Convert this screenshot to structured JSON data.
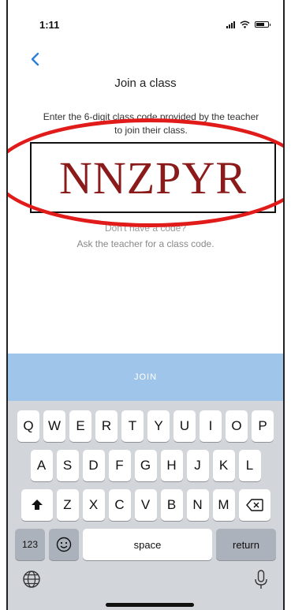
{
  "status_bar": {
    "time": "1:11"
  },
  "header": {
    "back_icon": "chevron-left-icon",
    "title": "Join a class"
  },
  "instruction": "Enter the 6-digit class code provided by the teacher to join their class.",
  "code": "NNZPYR",
  "help": {
    "question": "Don't have a code?",
    "hint": "Ask the teacher for a class code."
  },
  "join_button": {
    "label": "JOIN"
  },
  "colors": {
    "accent": "#2b7fd8",
    "join_bg": "#9fc6ea",
    "annotation": "#e11a1a",
    "code_text": "#8b1a1a"
  },
  "keyboard": {
    "row1": [
      "Q",
      "W",
      "E",
      "R",
      "T",
      "Y",
      "U",
      "I",
      "O",
      "P"
    ],
    "row2": [
      "A",
      "S",
      "D",
      "F",
      "G",
      "H",
      "J",
      "K",
      "L"
    ],
    "row3": [
      "Z",
      "X",
      "C",
      "V",
      "B",
      "N",
      "M"
    ],
    "numbers_label": "123",
    "space_label": "space",
    "return_label": "return",
    "shift_icon": "shift-icon",
    "delete_icon": "delete-icon",
    "emoji_icon": "emoji-icon",
    "globe_icon": "globe-icon",
    "mic_icon": "microphone-icon"
  }
}
